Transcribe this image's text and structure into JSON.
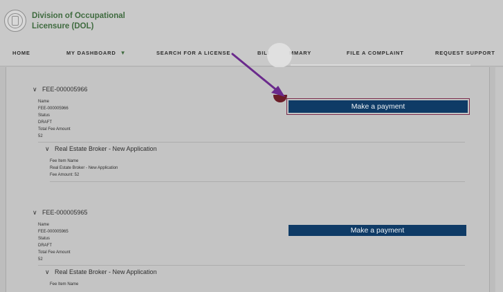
{
  "header": {
    "agency_line1": "Division of Occupational",
    "agency_line2": "Licensure (DOL)"
  },
  "nav": {
    "home": "HOME",
    "dashboard": "MY DASHBOARD",
    "dashboard_caret": "▼",
    "search": "SEARCH FOR A LICENSE",
    "billing_left": "BILI",
    "billing_right": "MMARY",
    "complaint": "FILE A COMPLAINT",
    "support": "REQUEST SUPPORT"
  },
  "records": [
    {
      "chevron": "∨",
      "id": "FEE-000005966",
      "name_label": "Name",
      "name_value": "FEE-000005966",
      "status_label": "Status",
      "status_value": "DRAFT",
      "total_label": "Total Fee Amount",
      "total_value": "52",
      "item_chevron": "∨",
      "item_title": "Real Estate Broker - New Application",
      "item_name_label": "Fee Item Name",
      "item_name_value": "Real Estate Broker - New Application",
      "item_amount": "Fee Amount: 52",
      "pay_label": "Make a payment"
    },
    {
      "chevron": "∨",
      "id": "FEE-000005965",
      "name_label": "Name",
      "name_value": "FEE-000005965",
      "status_label": "Status",
      "status_value": "DRAFT",
      "total_label": "Total Fee Amount",
      "total_value": "52",
      "item_chevron": "∨",
      "item_title": "Real Estate Broker - New Application",
      "item_name_label": "Fee Item Name",
      "pay_label": "Make a payment"
    }
  ],
  "colors": {
    "brand_green": "#3f6b3f",
    "button_navy": "#0f3b66",
    "arrow_purple": "#6a2a8c"
  }
}
